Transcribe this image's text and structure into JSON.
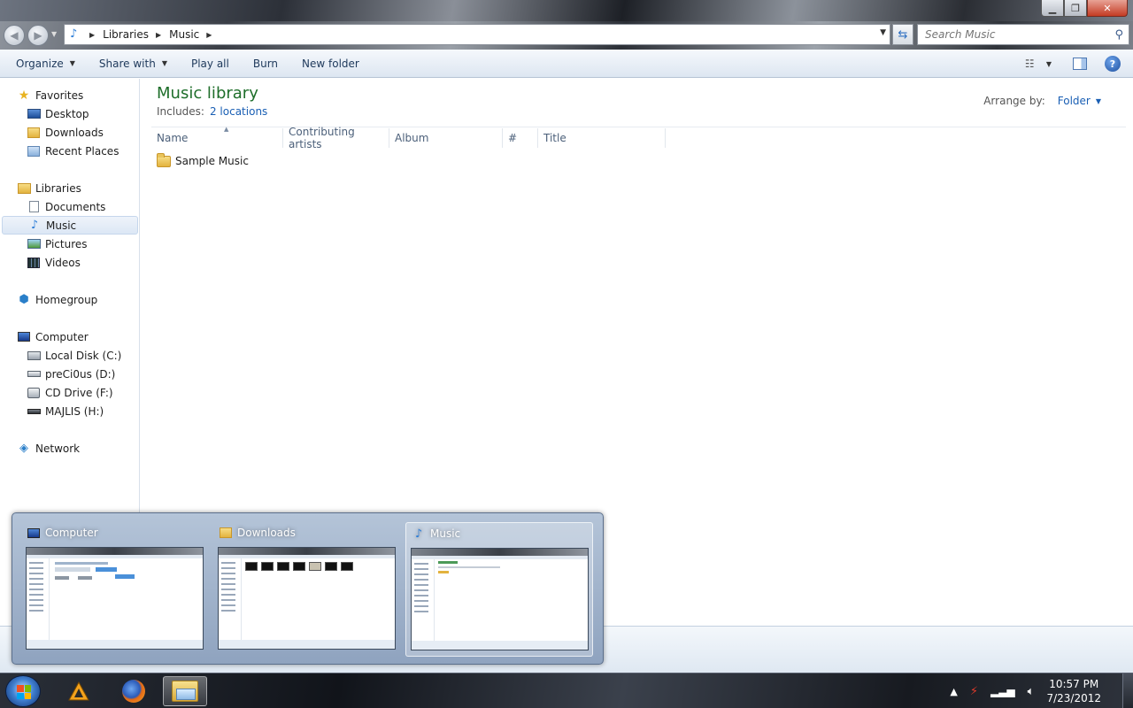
{
  "window": {
    "buttons": {
      "minimize": "▁",
      "maximize": "❐",
      "close": "✕"
    }
  },
  "nav": {
    "back_glyph": "◀",
    "forward_glyph": "▶",
    "breadcrumb": [
      "Libraries",
      "Music"
    ],
    "search_placeholder": "Search Music"
  },
  "toolbar": {
    "organize": "Organize",
    "share_with": "Share with",
    "play_all": "Play all",
    "burn": "Burn",
    "new_folder": "New folder"
  },
  "sidebar": {
    "favorites": {
      "label": "Favorites",
      "items": [
        "Desktop",
        "Downloads",
        "Recent Places"
      ]
    },
    "libraries": {
      "label": "Libraries",
      "items": [
        "Documents",
        "Music",
        "Pictures",
        "Videos"
      ],
      "selected": "Music"
    },
    "homegroup": "Homegroup",
    "computer": {
      "label": "Computer",
      "items": [
        "Local Disk (C:)",
        "preCi0us (D:)",
        "CD Drive (F:)",
        "MAJLIS (H:)"
      ]
    },
    "network": "Network"
  },
  "main": {
    "title": "Music library",
    "includes_label": "Includes:",
    "includes_link": "2 locations",
    "arrange_label": "Arrange by:",
    "arrange_value": "Folder",
    "columns": [
      "Name",
      "Contributing artists",
      "Album",
      "#",
      "Title"
    ],
    "files": [
      {
        "name": "Sample Music",
        "type": "folder"
      }
    ]
  },
  "thumbnails": [
    {
      "title": "Computer",
      "icon": "computer-icon",
      "active": false
    },
    {
      "title": "Downloads",
      "icon": "downloads-folder-icon",
      "active": false
    },
    {
      "title": "Music",
      "icon": "music-library-icon",
      "active": true
    }
  ],
  "taskbar": {
    "time": "10:57 PM",
    "date": "7/23/2012"
  },
  "colors": {
    "accent": "#1a5fb4",
    "library_title": "#1e6e2a"
  }
}
